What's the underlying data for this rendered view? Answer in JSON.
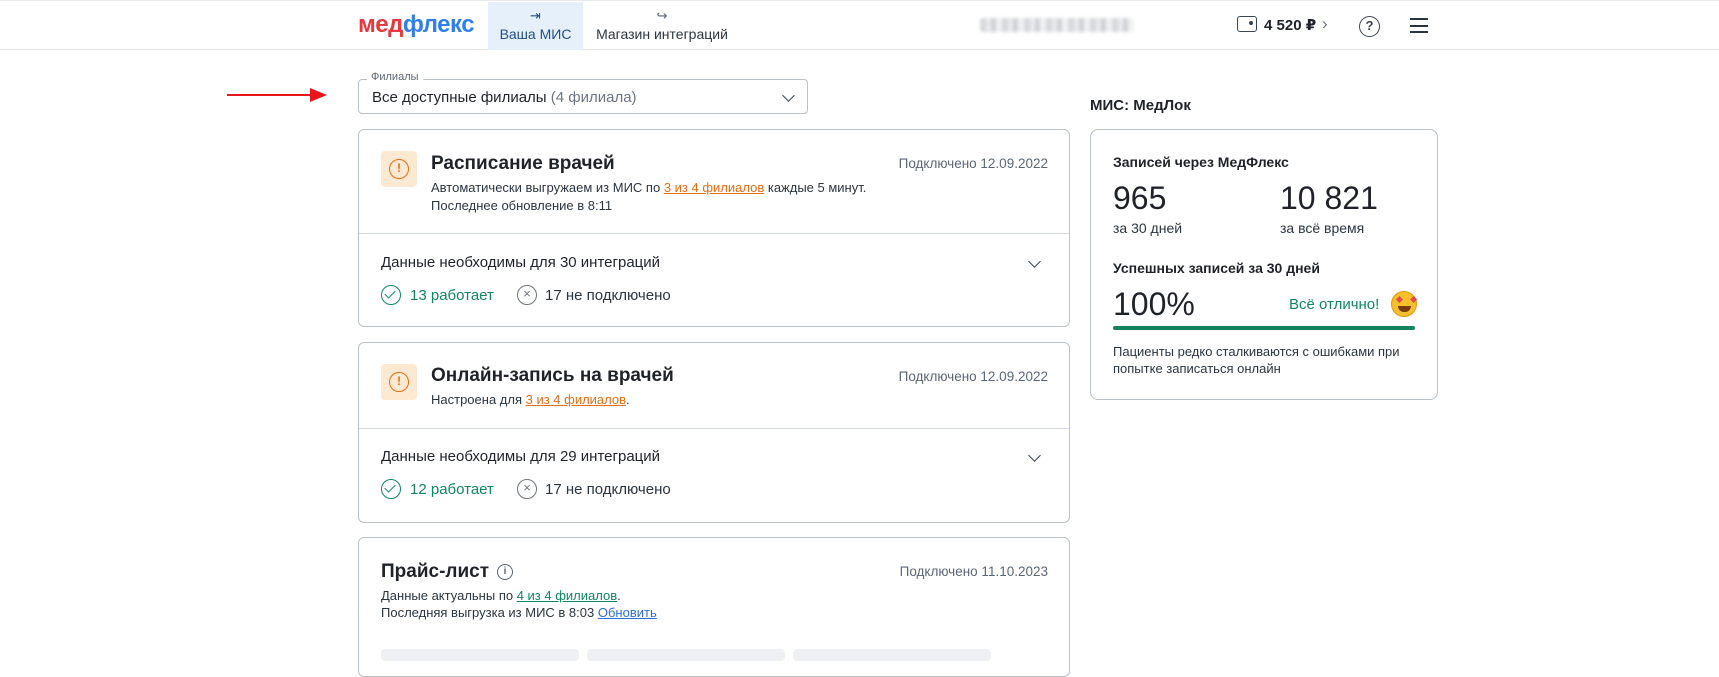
{
  "header": {
    "logo_part1": "мед",
    "logo_part2": "флекс",
    "tabs": [
      {
        "label": "Ваша МИС",
        "icon": "login-icon",
        "active": true
      },
      {
        "label": "Магазин интеграций",
        "icon": "logout-icon",
        "active": false
      }
    ],
    "balance": "4 520 ₽"
  },
  "filter": {
    "legend": "Филиалы",
    "value": "Все доступные филиалы",
    "count": "(4 филиала)"
  },
  "cards": [
    {
      "title": "Расписание врачей",
      "date": "Подключено 12.09.2022",
      "line1_pre": "Автоматически выгружаем из МИС по ",
      "line1_link": "3 из 4 филиалов",
      "line1_post": " каждые 5 минут.",
      "line2": "Последнее обновление в 8:11",
      "need": "Данные необходимы для 30 интеграций",
      "ok": "13 работает",
      "fail": "17 не подключено"
    },
    {
      "title": "Онлайн-запись на врачей",
      "date": "Подключено 12.09.2022",
      "line1_pre": "Настроена для ",
      "line1_link": "3 из 4 филиалов",
      "line1_post": ".",
      "need": "Данные необходимы для 29 интеграций",
      "ok": "12 работает",
      "fail": "17 не подключено"
    },
    {
      "title": "Прайс-лист",
      "date": "Подключено 11.10.2023",
      "line1_pre": "Данные актуальны по ",
      "line1_link": "4 из 4 филиалов",
      "line1_post": ".",
      "line2_pre": "Последняя выгрузка из МИС в 8:03 ",
      "line2_link": "Обновить"
    }
  ],
  "sidebar": {
    "title": "МИС: МедЛок",
    "bookings_label": "Записей через МедФлекс",
    "count_30": "965",
    "count_30_label": "за 30 дней",
    "count_all": "10 821",
    "count_all_label": "за всё время",
    "success_label": "Успешных записей за 30 дней",
    "success_value": "100%",
    "success_progress": 1.0,
    "success_status": "Всё отлично!",
    "note": "Пациенты редко сталкиваются с ошибками при попытке записаться онлайн"
  },
  "colors": {
    "accent": "#2f80ed",
    "warning": "#e46e14",
    "success": "#12855e",
    "arrow": "#e8161b"
  }
}
